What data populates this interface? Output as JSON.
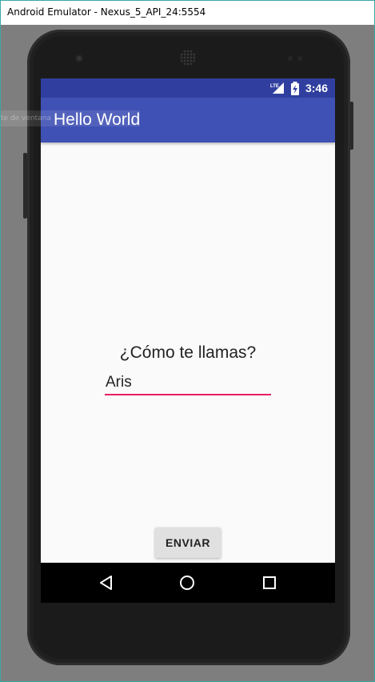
{
  "window": {
    "title": "Android Emulator - Nexus_5_API_24:5554",
    "ghost_text": "te de ventana"
  },
  "status_bar": {
    "network": "LTE",
    "time": "3:46"
  },
  "app_bar": {
    "title": "Hello World"
  },
  "form": {
    "question": "¿Cómo te llamas?",
    "name_value": "Aris",
    "send_label": "ENVIAR"
  },
  "nav_bar": {
    "icons": [
      "back-icon",
      "home-icon",
      "recents-icon"
    ]
  },
  "colors": {
    "status_bar": "#303f9f",
    "app_bar": "#3f51b5",
    "accent": "#e91e63",
    "background": "#fafafa"
  }
}
